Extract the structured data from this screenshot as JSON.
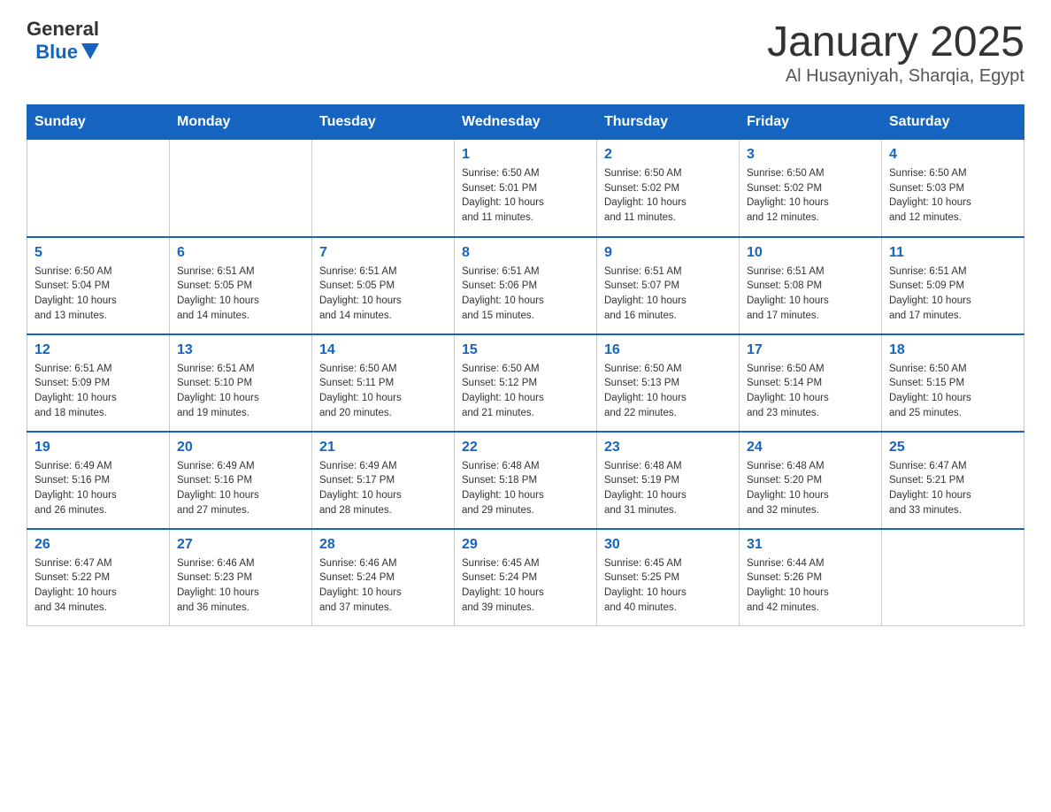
{
  "logo": {
    "general": "General",
    "blue": "Blue"
  },
  "header": {
    "title": "January 2025",
    "subtitle": "Al Husayniyah, Sharqia, Egypt"
  },
  "weekdays": [
    "Sunday",
    "Monday",
    "Tuesday",
    "Wednesday",
    "Thursday",
    "Friday",
    "Saturday"
  ],
  "weeks": [
    [
      {
        "day": "",
        "info": ""
      },
      {
        "day": "",
        "info": ""
      },
      {
        "day": "",
        "info": ""
      },
      {
        "day": "1",
        "info": "Sunrise: 6:50 AM\nSunset: 5:01 PM\nDaylight: 10 hours\nand 11 minutes."
      },
      {
        "day": "2",
        "info": "Sunrise: 6:50 AM\nSunset: 5:02 PM\nDaylight: 10 hours\nand 11 minutes."
      },
      {
        "day": "3",
        "info": "Sunrise: 6:50 AM\nSunset: 5:02 PM\nDaylight: 10 hours\nand 12 minutes."
      },
      {
        "day": "4",
        "info": "Sunrise: 6:50 AM\nSunset: 5:03 PM\nDaylight: 10 hours\nand 12 minutes."
      }
    ],
    [
      {
        "day": "5",
        "info": "Sunrise: 6:50 AM\nSunset: 5:04 PM\nDaylight: 10 hours\nand 13 minutes."
      },
      {
        "day": "6",
        "info": "Sunrise: 6:51 AM\nSunset: 5:05 PM\nDaylight: 10 hours\nand 14 minutes."
      },
      {
        "day": "7",
        "info": "Sunrise: 6:51 AM\nSunset: 5:05 PM\nDaylight: 10 hours\nand 14 minutes."
      },
      {
        "day": "8",
        "info": "Sunrise: 6:51 AM\nSunset: 5:06 PM\nDaylight: 10 hours\nand 15 minutes."
      },
      {
        "day": "9",
        "info": "Sunrise: 6:51 AM\nSunset: 5:07 PM\nDaylight: 10 hours\nand 16 minutes."
      },
      {
        "day": "10",
        "info": "Sunrise: 6:51 AM\nSunset: 5:08 PM\nDaylight: 10 hours\nand 17 minutes."
      },
      {
        "day": "11",
        "info": "Sunrise: 6:51 AM\nSunset: 5:09 PM\nDaylight: 10 hours\nand 17 minutes."
      }
    ],
    [
      {
        "day": "12",
        "info": "Sunrise: 6:51 AM\nSunset: 5:09 PM\nDaylight: 10 hours\nand 18 minutes."
      },
      {
        "day": "13",
        "info": "Sunrise: 6:51 AM\nSunset: 5:10 PM\nDaylight: 10 hours\nand 19 minutes."
      },
      {
        "day": "14",
        "info": "Sunrise: 6:50 AM\nSunset: 5:11 PM\nDaylight: 10 hours\nand 20 minutes."
      },
      {
        "day": "15",
        "info": "Sunrise: 6:50 AM\nSunset: 5:12 PM\nDaylight: 10 hours\nand 21 minutes."
      },
      {
        "day": "16",
        "info": "Sunrise: 6:50 AM\nSunset: 5:13 PM\nDaylight: 10 hours\nand 22 minutes."
      },
      {
        "day": "17",
        "info": "Sunrise: 6:50 AM\nSunset: 5:14 PM\nDaylight: 10 hours\nand 23 minutes."
      },
      {
        "day": "18",
        "info": "Sunrise: 6:50 AM\nSunset: 5:15 PM\nDaylight: 10 hours\nand 25 minutes."
      }
    ],
    [
      {
        "day": "19",
        "info": "Sunrise: 6:49 AM\nSunset: 5:16 PM\nDaylight: 10 hours\nand 26 minutes."
      },
      {
        "day": "20",
        "info": "Sunrise: 6:49 AM\nSunset: 5:16 PM\nDaylight: 10 hours\nand 27 minutes."
      },
      {
        "day": "21",
        "info": "Sunrise: 6:49 AM\nSunset: 5:17 PM\nDaylight: 10 hours\nand 28 minutes."
      },
      {
        "day": "22",
        "info": "Sunrise: 6:48 AM\nSunset: 5:18 PM\nDaylight: 10 hours\nand 29 minutes."
      },
      {
        "day": "23",
        "info": "Sunrise: 6:48 AM\nSunset: 5:19 PM\nDaylight: 10 hours\nand 31 minutes."
      },
      {
        "day": "24",
        "info": "Sunrise: 6:48 AM\nSunset: 5:20 PM\nDaylight: 10 hours\nand 32 minutes."
      },
      {
        "day": "25",
        "info": "Sunrise: 6:47 AM\nSunset: 5:21 PM\nDaylight: 10 hours\nand 33 minutes."
      }
    ],
    [
      {
        "day": "26",
        "info": "Sunrise: 6:47 AM\nSunset: 5:22 PM\nDaylight: 10 hours\nand 34 minutes."
      },
      {
        "day": "27",
        "info": "Sunrise: 6:46 AM\nSunset: 5:23 PM\nDaylight: 10 hours\nand 36 minutes."
      },
      {
        "day": "28",
        "info": "Sunrise: 6:46 AM\nSunset: 5:24 PM\nDaylight: 10 hours\nand 37 minutes."
      },
      {
        "day": "29",
        "info": "Sunrise: 6:45 AM\nSunset: 5:24 PM\nDaylight: 10 hours\nand 39 minutes."
      },
      {
        "day": "30",
        "info": "Sunrise: 6:45 AM\nSunset: 5:25 PM\nDaylight: 10 hours\nand 40 minutes."
      },
      {
        "day": "31",
        "info": "Sunrise: 6:44 AM\nSunset: 5:26 PM\nDaylight: 10 hours\nand 42 minutes."
      },
      {
        "day": "",
        "info": ""
      }
    ]
  ]
}
